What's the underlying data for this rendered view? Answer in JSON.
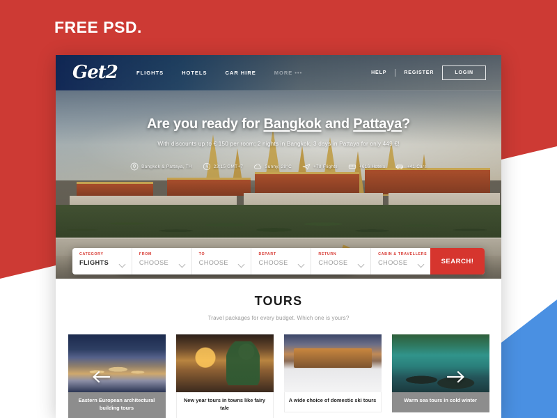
{
  "meta": {
    "badge_label": "FREE PSD.",
    "colors": {
      "brand_red": "#d6352e",
      "accent_blue": "#4a90e2",
      "nav_dark": "#0c2352",
      "caption_hover_gray": "#8d8d8d"
    }
  },
  "nav": {
    "logo_text": "Get2",
    "links": [
      {
        "label": "FLIGHTS",
        "muted": false
      },
      {
        "label": "HOTELS",
        "muted": false
      },
      {
        "label": "CAR HIRE",
        "muted": false
      },
      {
        "label": "MORE •••",
        "muted": true
      }
    ],
    "help_label": "HELP",
    "register_label": "REGISTER",
    "login_label": "LOGIN"
  },
  "hero": {
    "title_prefix": "Are you ready for ",
    "title_link_1": "Bangkok",
    "title_join": " and ",
    "title_link_2": "Pattaya",
    "title_suffix": "?",
    "subtitle": "With discounts up to € 150 per room; 2 nights in Bangkok, 3 days in Pattaya for only 449 €!",
    "stats": [
      {
        "icon": "map-pin-icon",
        "text": "Bangkok & Pattaya, TH"
      },
      {
        "icon": "clock-icon",
        "text": "23:15 GMT+7"
      },
      {
        "icon": "cloud-icon",
        "text": "Sunny, 28°C"
      },
      {
        "icon": "plane-icon",
        "text": "+78 Flights"
      },
      {
        "icon": "bed-icon",
        "text": "+616 Hotels"
      },
      {
        "icon": "car-icon",
        "text": "+41 Cars"
      }
    ]
  },
  "search": {
    "fields": [
      {
        "label": "CATEGORY",
        "value": "FLIGHTS",
        "active": true
      },
      {
        "label": "FROM",
        "value": "CHOOSE",
        "active": false
      },
      {
        "label": "TO",
        "value": "CHOOSE",
        "active": false
      },
      {
        "label": "DEPART",
        "value": "CHOOSE",
        "active": false
      },
      {
        "label": "RETURN",
        "value": "CHOOSE",
        "active": false
      },
      {
        "label": "CABIN & TRAVELLERS",
        "value": "CHOOSE",
        "active": false
      }
    ],
    "button_label": "SEARCH!"
  },
  "tours": {
    "heading": "TOURS",
    "subheading": "Travel packages for every budget. Which one is yours?",
    "prev_label": "Previous tours",
    "next_label": "Next tours",
    "cards": [
      {
        "caption": "Eastern European architectural building tours",
        "photo": "ph-castle",
        "hovered": true
      },
      {
        "caption": "New year tours in towns like fairy tale",
        "photo": "ph-xmas",
        "hovered": false
      },
      {
        "caption": "A wide choice of domestic ski tours",
        "photo": "ph-ski",
        "hovered": false
      },
      {
        "caption": "Warm sea tours in cold winter",
        "photo": "ph-sea",
        "hovered": true
      }
    ]
  }
}
